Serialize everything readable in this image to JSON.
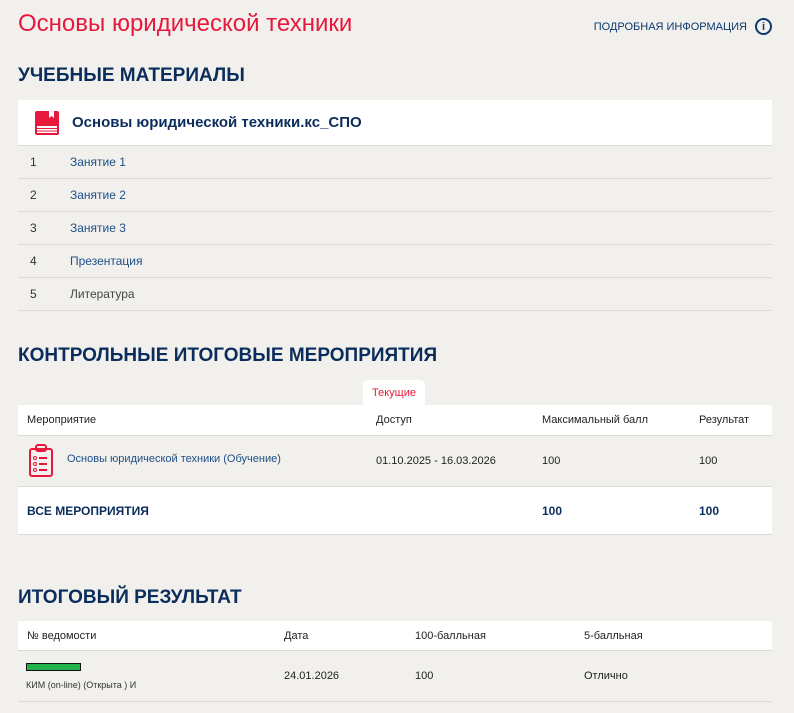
{
  "header": {
    "title": "Основы юридической техники",
    "info_link": "ПОДРОБНАЯ ИНФОРМАЦИЯ",
    "info_icon": "i"
  },
  "materials": {
    "heading": "УЧЕБНЫЕ МАТЕРИАЛЫ",
    "course": "Основы юридической техники.кс_СПО",
    "items": [
      {
        "n": "1",
        "label": "Занятие 1"
      },
      {
        "n": "2",
        "label": "Занятие 2"
      },
      {
        "n": "3",
        "label": "Занятие 3"
      },
      {
        "n": "4",
        "label": "Презентация"
      },
      {
        "n": "5",
        "label": "Литература"
      }
    ]
  },
  "control": {
    "heading": "КОНТРОЛЬНЫЕ ИТОГОВЫЕ МЕРОПРИЯТИЯ",
    "tab": "Текущие",
    "columns": [
      "Мероприятие",
      "Доступ",
      "Максимальный балл",
      "Результат"
    ],
    "rows": [
      {
        "name": "Основы юридической техники (Обучение)",
        "access": "01.10.2025 - 16.03.2026",
        "max": "100",
        "result": "100"
      }
    ],
    "total": {
      "label": "ВСЕ МЕРОПРИЯТИЯ",
      "max": "100",
      "result": "100"
    }
  },
  "final": {
    "heading": "ИТОГОВЫЙ РЕЗУЛЬТАТ",
    "columns": [
      "№ ведомости",
      "Дата",
      "100-балльная",
      "5-балльная"
    ],
    "rows": [
      {
        "progress_percent": 100,
        "sheet": "КИМ (on-line) (Открыта ) И",
        "date": "24.01.2026",
        "score100": "100",
        "score5": "Отлично"
      }
    ]
  },
  "colors": {
    "accent": "#e8173c",
    "heading": "#0b2d5c",
    "progress": "#22b14c"
  }
}
